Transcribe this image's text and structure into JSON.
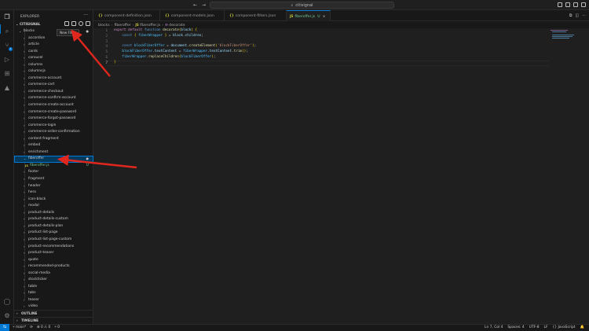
{
  "titlebar": {
    "back": "←",
    "forward": "→",
    "search": "citisignal"
  },
  "sidebar": {
    "title": "EXPLORER",
    "more": "···",
    "project": "CITISIGNAL",
    "tooltip": "New File...",
    "tree": [
      {
        "label": "blocks",
        "expanded": true,
        "dot": "●"
      },
      {
        "label": "accordion"
      },
      {
        "label": "article"
      },
      {
        "label": "cards"
      },
      {
        "label": "carousel"
      },
      {
        "label": "columns"
      },
      {
        "label": "columnsjs"
      },
      {
        "label": "commerce-account"
      },
      {
        "label": "commerce-cart"
      },
      {
        "label": "commerce-checkout"
      },
      {
        "label": "commerce-confirm-account"
      },
      {
        "label": "commerce-create-account"
      },
      {
        "label": "commerce-create-password"
      },
      {
        "label": "commerce-forgot-password"
      },
      {
        "label": "commerce-login"
      },
      {
        "label": "commerce-order-confirmation"
      },
      {
        "label": "content-fragment"
      },
      {
        "label": "embed"
      },
      {
        "label": "enrichment"
      },
      {
        "label": "fiberoffer",
        "expanded": true,
        "selected": true,
        "dot": "●"
      },
      {
        "label": "fiberoffer.js",
        "file": true,
        "status": "U"
      },
      {
        "label": "footer"
      },
      {
        "label": "fragment"
      },
      {
        "label": "header"
      },
      {
        "label": "hero"
      },
      {
        "label": "icon-block"
      },
      {
        "label": "modal"
      },
      {
        "label": "product-details"
      },
      {
        "label": "product-details-custom"
      },
      {
        "label": "product-details-plan"
      },
      {
        "label": "product-list-page"
      },
      {
        "label": "product-list-page-custom"
      },
      {
        "label": "product-recommendations"
      },
      {
        "label": "product-teaser"
      },
      {
        "label": "quote"
      },
      {
        "label": "recommended-products"
      },
      {
        "label": "social-media"
      },
      {
        "label": "stockticker"
      },
      {
        "label": "table"
      },
      {
        "label": "tabs"
      },
      {
        "label": "teaser"
      },
      {
        "label": "video"
      }
    ],
    "outline": "OUTLINE",
    "timeline": "TIMELINE"
  },
  "tabs": [
    {
      "icon": "{}",
      "label": "component-definition.json"
    },
    {
      "icon": "{}",
      "label": "component-models.json"
    },
    {
      "icon": "{}",
      "label": "component-filters.json"
    },
    {
      "icon": "JS",
      "label": "fiberoffer.js",
      "modified": "U",
      "close": "×",
      "active": true
    }
  ],
  "breadcrumb": [
    "blocks",
    "fiberoffer",
    "fiberoffer.js",
    "decorate"
  ],
  "code": {
    "line_numbers": [
      "1",
      "2",
      "3",
      "4",
      "5",
      "6",
      "7"
    ],
    "current_line": 7
  },
  "statusbar": {
    "remote": "⇆",
    "branch": "main*",
    "sync": "⟳",
    "problems": "⊗ 0 ⚠ 0",
    "ports": "⑂ 0",
    "position": "Ln 7, Col 4",
    "spaces": "Spaces: 4",
    "encoding": "UTF-8",
    "eol": "LF",
    "language": "{} JavaScript",
    "bell": "🔔"
  },
  "colors": {
    "accent": "#0078d4",
    "annotation_arrow": "#e0271d"
  }
}
